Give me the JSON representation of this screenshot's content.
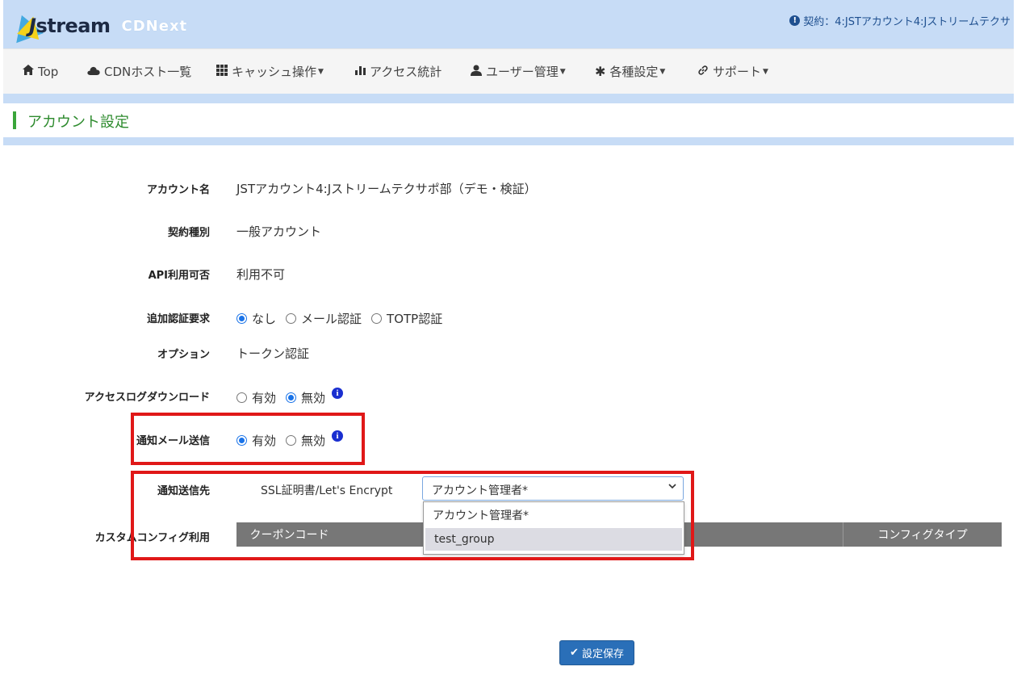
{
  "header": {
    "logo_text": "stream",
    "logo_letter": "J",
    "logo_sub": "CDNext",
    "contract_text": "契約：4:JSTアカウント4:Jストリームテクサ"
  },
  "nav": {
    "items": [
      {
        "label": "Top",
        "icon": "home-icon"
      },
      {
        "label": "CDNホスト一覧",
        "icon": "cloud-icon"
      },
      {
        "label": "キャッシュ操作",
        "icon": "grid-icon",
        "dropdown": true
      },
      {
        "label": "アクセス統計",
        "icon": "bar-chart-icon"
      },
      {
        "label": "ユーザー管理",
        "icon": "user-icon",
        "dropdown": true
      },
      {
        "label": "各種設定",
        "icon": "gear-icon",
        "dropdown": true
      },
      {
        "label": "サポート",
        "icon": "link-icon",
        "dropdown": true
      }
    ]
  },
  "page": {
    "title": "アカウント設定"
  },
  "form": {
    "account_name": {
      "label": "アカウント名",
      "value": "JSTアカウント4:Jストリームテクサポ部（デモ・検証）"
    },
    "contract_type": {
      "label": "契約種別",
      "value": "一般アカウント"
    },
    "api": {
      "label": "API利用可否",
      "value": "利用不可"
    },
    "auth": {
      "label": "追加認証要求",
      "options": [
        "なし",
        "メール認証",
        "TOTP認証"
      ],
      "selected": "なし"
    },
    "option": {
      "label": "オプション",
      "value": "トークン認証"
    },
    "log_download": {
      "label": "アクセスログダウンロード",
      "options": [
        "有効",
        "無効"
      ],
      "selected": "無効"
    },
    "notify_mail": {
      "label": "通知メール送信",
      "options": [
        "有効",
        "無効"
      ],
      "selected": "有効"
    },
    "notify_dest": {
      "label": "通知送信先",
      "item": "SSL証明書/Let's Encrypt",
      "select_value": "アカウント管理者*",
      "options": [
        "アカウント管理者*",
        "test_group"
      ],
      "highlighted": "test_group"
    },
    "custom_config": {
      "label": "カスタムコンフィグ利用",
      "columns": [
        "クーポンコード",
        "",
        "コンフィグタイプ"
      ]
    },
    "save_label": "設定保存"
  },
  "colors": {
    "header_bg": "#c7dcf6",
    "accent_green": "#3aa53a",
    "highlight_red": "#e01818",
    "button_blue": "#2a6fb8"
  }
}
